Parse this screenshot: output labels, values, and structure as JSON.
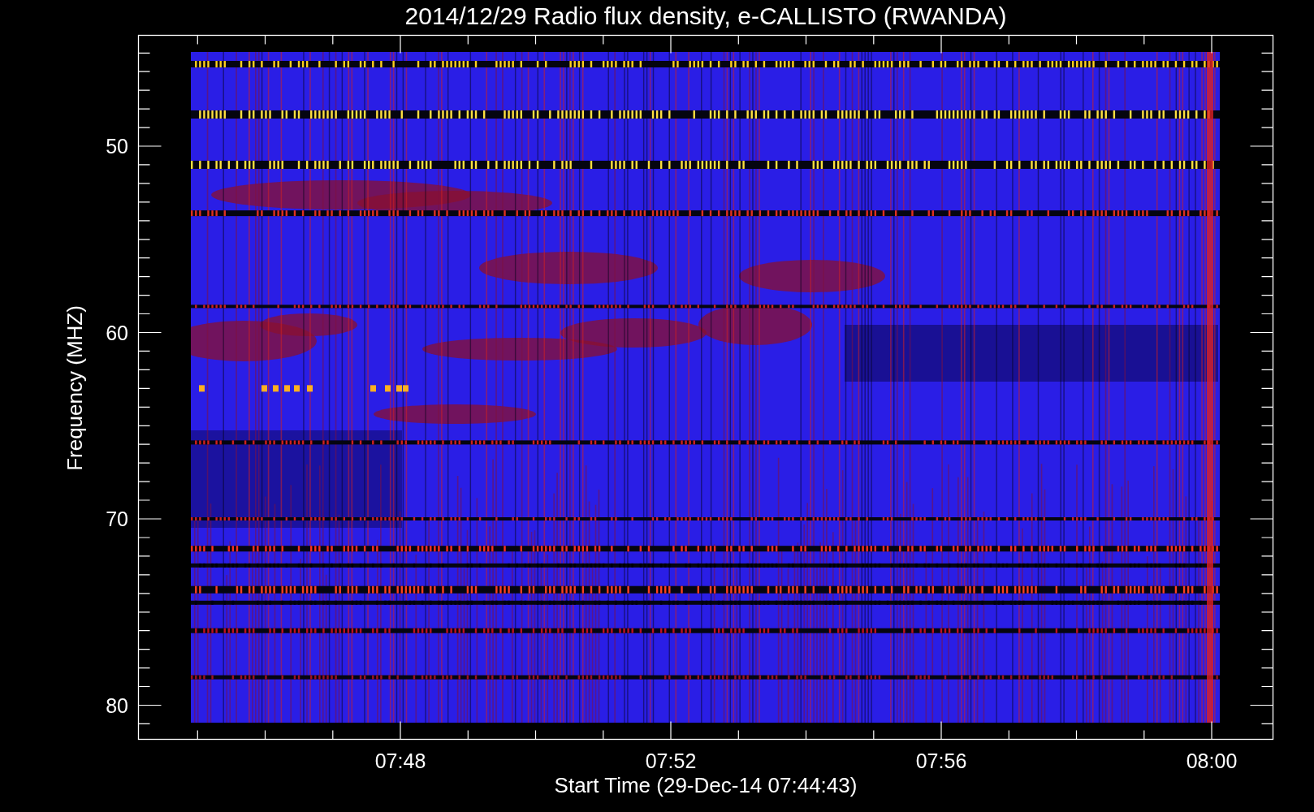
{
  "title": "2014/12/29  Radio flux density, e-CALLISTO (RWANDA)",
  "ylabel": "Frequency (MHZ)",
  "xlabel": "Start Time (29-Dec-14 07:44:43)",
  "yticks": [
    "50",
    "60",
    "70",
    "80"
  ],
  "xticks": [
    "07:48",
    "07:52",
    "07:56",
    "08:00"
  ]
}
